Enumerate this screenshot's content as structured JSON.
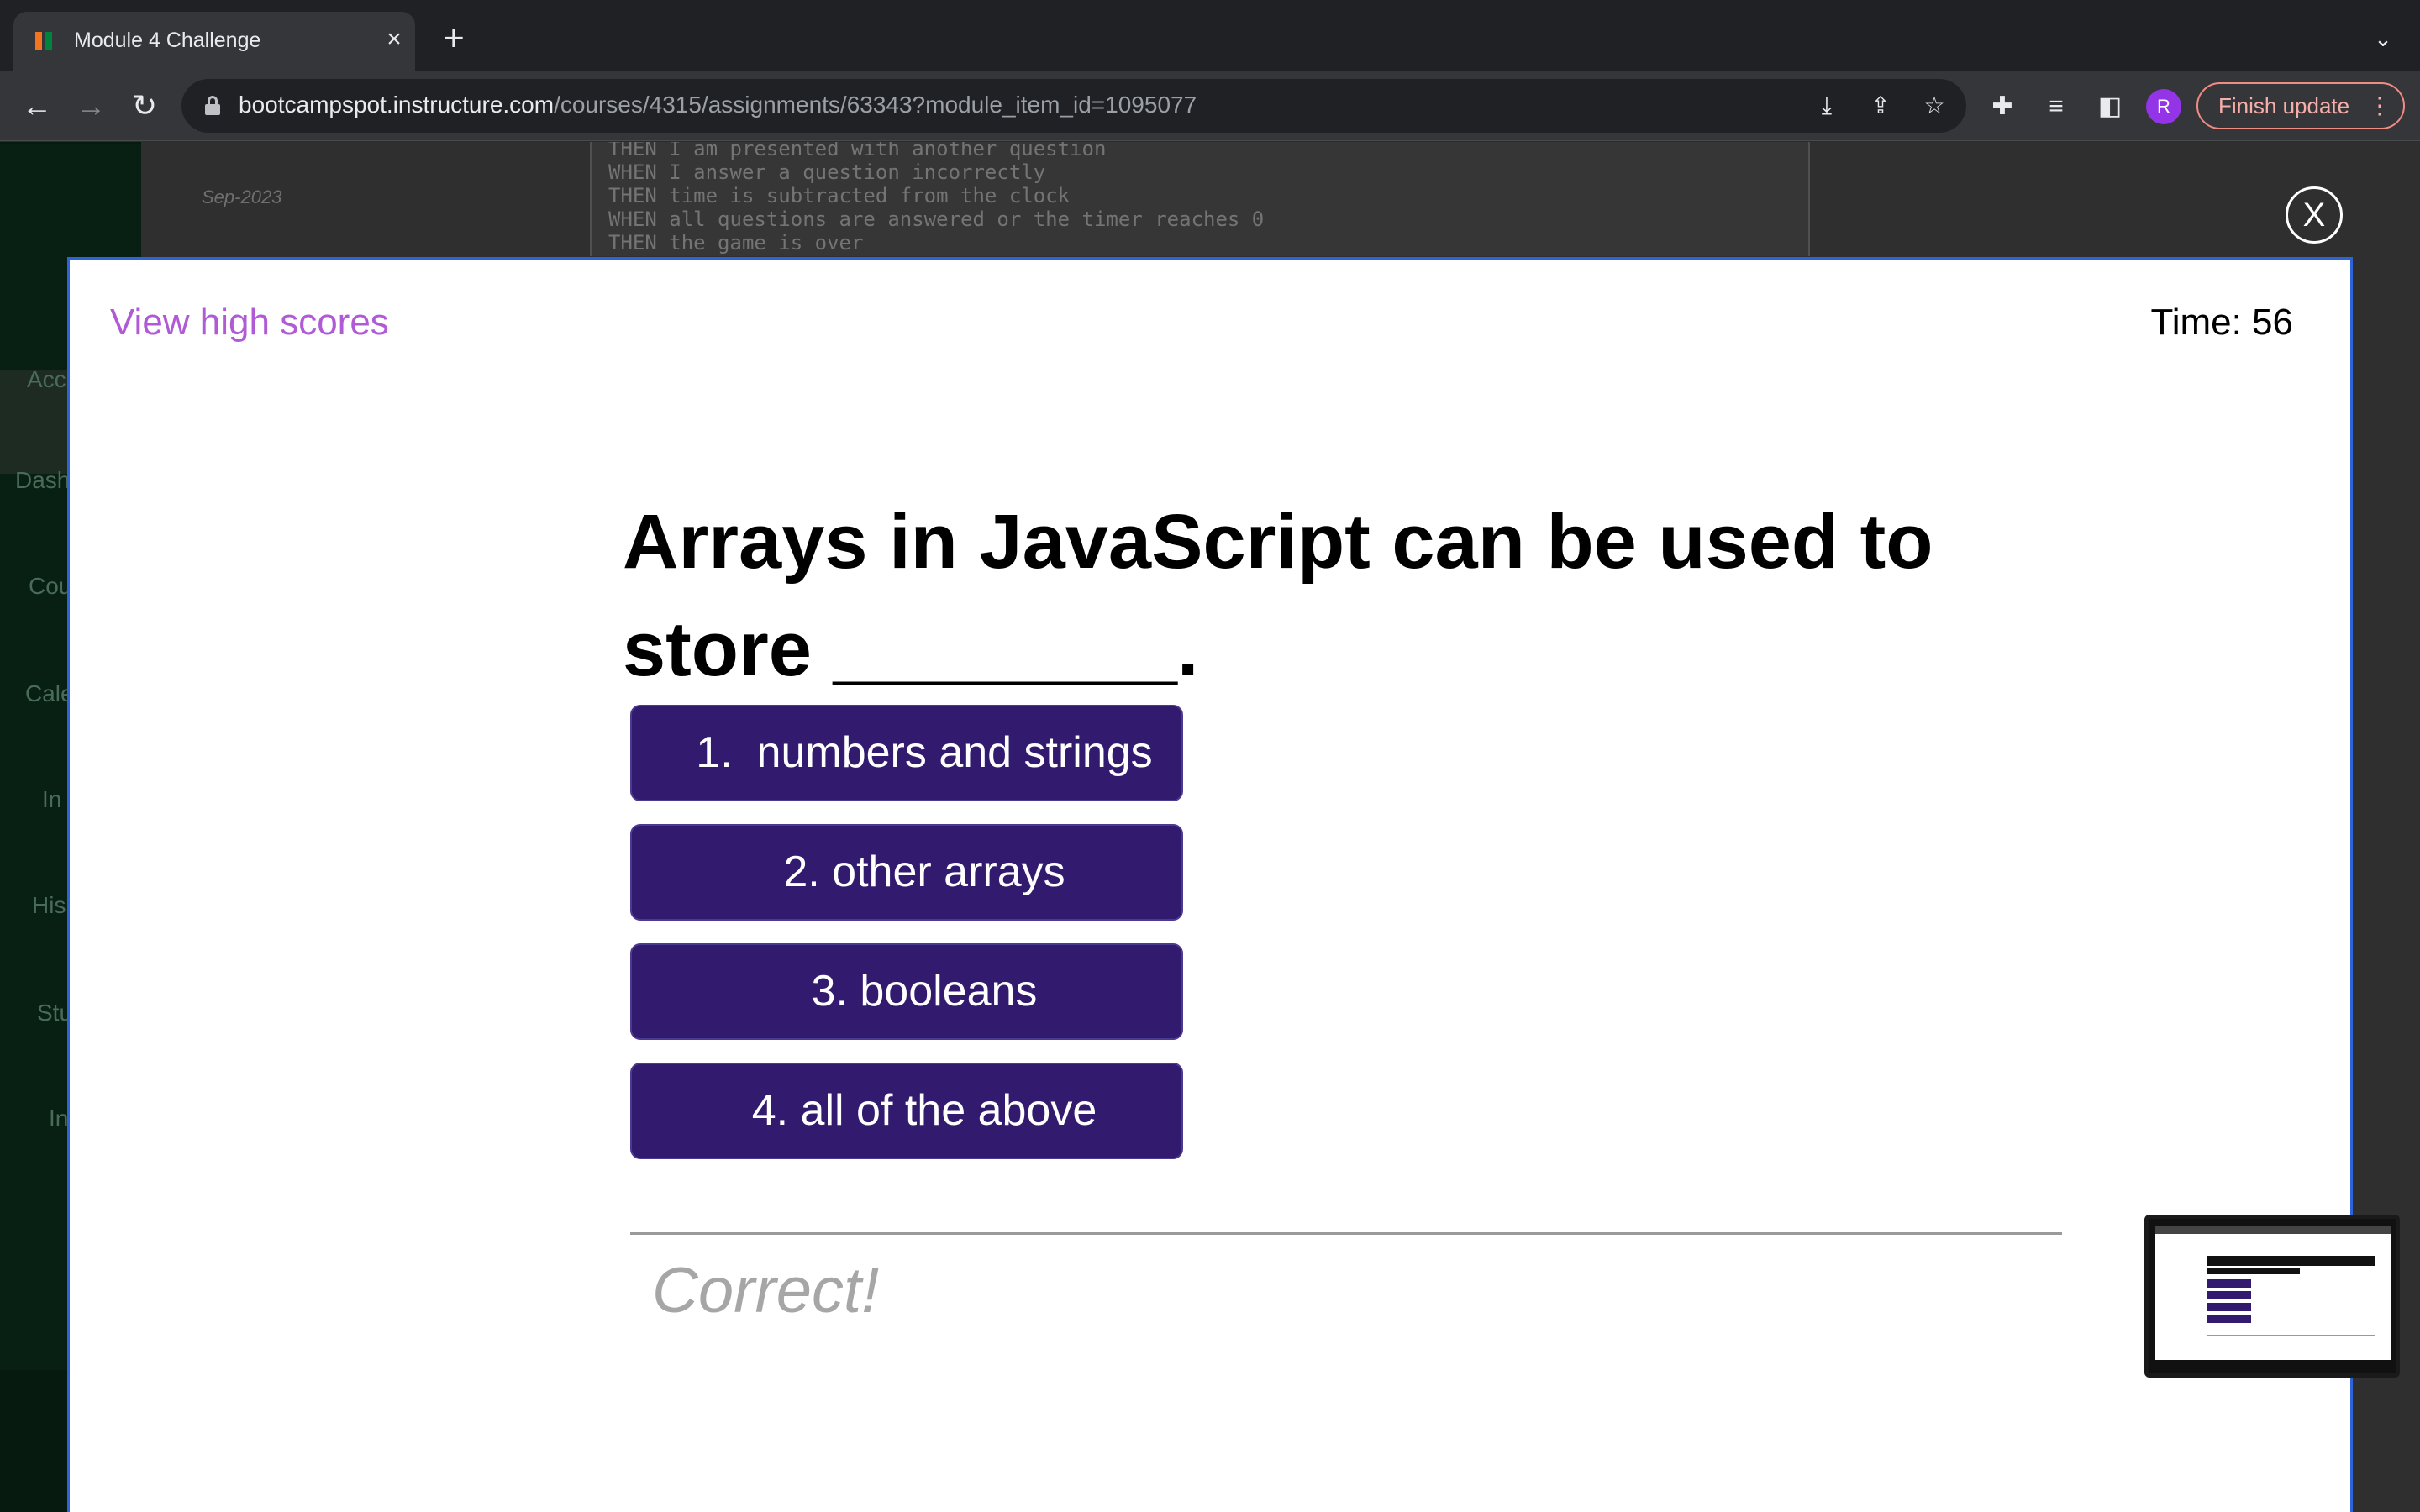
{
  "browser": {
    "tab_title": "Module 4 Challenge",
    "url_host": "bootcampspot.instructure.com",
    "url_path": "/courses/4315/assignments/63343?module_item_id=1095077",
    "profile_initial": "R",
    "finish_update_label": "Finish update"
  },
  "background": {
    "date": "Sep-2023",
    "code_lines": [
      "THEN I am presented with another question",
      "WHEN I answer a question incorrectly",
      "THEN time is subtracted from the clock",
      "WHEN all questions are answered or the timer reaches 0",
      "THEN the game is over"
    ],
    "nav_fragments": [
      "Acc",
      "Dash",
      "Cou",
      "Cale",
      "In",
      "His",
      "Stu",
      "In"
    ]
  },
  "modal": {
    "close_label": "X",
    "view_high_scores": "View high scores",
    "timer": "Time: 56",
    "question": "Arrays in JavaScript can be used to store ________.",
    "choices": [
      "1.  numbers and strings",
      "2. other arrays",
      "3. booleans",
      "4. all of the above"
    ],
    "result": "Correct!"
  },
  "colors": {
    "accent": "#b05ad6",
    "choice_bg": "#321b6e",
    "modal_border": "#2f63d8"
  }
}
